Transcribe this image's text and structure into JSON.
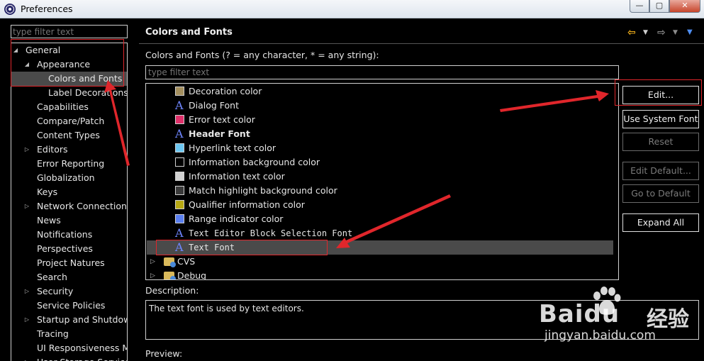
{
  "window": {
    "title": "Preferences",
    "min_glyph": "—",
    "max_glyph": "▢",
    "close_glyph": "✕"
  },
  "left": {
    "filter_placeholder": "type filter text",
    "tree": [
      {
        "label": "General",
        "level": 0,
        "twisty": "◢"
      },
      {
        "label": "Appearance",
        "level": 1,
        "twisty": "◢"
      },
      {
        "label": "Colors and Fonts",
        "level": 2,
        "selected": true
      },
      {
        "label": "Label Decorations",
        "level": 2
      },
      {
        "label": "Capabilities",
        "level": 1
      },
      {
        "label": "Compare/Patch",
        "level": 1
      },
      {
        "label": "Content Types",
        "level": 1
      },
      {
        "label": "Editors",
        "level": 1,
        "twisty": "▷"
      },
      {
        "label": "Error Reporting",
        "level": 1
      },
      {
        "label": "Globalization",
        "level": 1
      },
      {
        "label": "Keys",
        "level": 1
      },
      {
        "label": "Network Connections",
        "level": 1,
        "twisty": "▷"
      },
      {
        "label": "News",
        "level": 1
      },
      {
        "label": "Notifications",
        "level": 1
      },
      {
        "label": "Perspectives",
        "level": 1
      },
      {
        "label": "Project Natures",
        "level": 1
      },
      {
        "label": "Search",
        "level": 1
      },
      {
        "label": "Security",
        "level": 1,
        "twisty": "▷"
      },
      {
        "label": "Service Policies",
        "level": 1
      },
      {
        "label": "Startup and Shutdown",
        "level": 1,
        "twisty": "▷"
      },
      {
        "label": "Tracing",
        "level": 1
      },
      {
        "label": "UI Responsiveness Monitoring",
        "level": 1
      },
      {
        "label": "User Storage Service",
        "level": 1,
        "twisty": "▷"
      }
    ]
  },
  "page": {
    "title": "Colors and Fonts",
    "nav": {
      "back": "⇦",
      "forward": "⇨",
      "dropdown": "▼",
      "menu": "▼"
    },
    "hint": "Colors and Fonts (? = any character, * = any string):",
    "filter_placeholder": "type filter text",
    "items": [
      {
        "label": "Decoration color",
        "kind": "color",
        "color": "#a48f5e"
      },
      {
        "label": "Dialog Font",
        "kind": "font"
      },
      {
        "label": "Error text color",
        "kind": "color",
        "color": "#e0306a"
      },
      {
        "label": "Header Font",
        "kind": "font",
        "style": "bold"
      },
      {
        "label": "Hyperlink text color",
        "kind": "color",
        "color": "#6cc7f2"
      },
      {
        "label": "Information background color",
        "kind": "color",
        "color": "#000000"
      },
      {
        "label": "Information text color",
        "kind": "color",
        "color": "#d2d2d2"
      },
      {
        "label": "Match highlight background color",
        "kind": "color",
        "color": "#3a3a3a"
      },
      {
        "label": "Qualifier information color",
        "kind": "color",
        "color": "#b7a813"
      },
      {
        "label": "Range indicator color",
        "kind": "color",
        "color": "#5a7ff0"
      },
      {
        "label": "Text Editor Block Selection Font",
        "kind": "font",
        "style": "mono"
      },
      {
        "label": "Text Font",
        "kind": "font",
        "style": "mono",
        "selected": true
      }
    ],
    "font_glyph": "A",
    "categories": [
      {
        "label": "CVS",
        "twisty": "▷"
      },
      {
        "label": "Debug",
        "twisty": "▷"
      }
    ],
    "buttons": {
      "edit": "Edit...",
      "use_system_font": "Use System Font",
      "reset": "Reset",
      "edit_default": "Edit Default...",
      "go_to_default": "Go to Default",
      "expand_all": "Expand All"
    },
    "description_label": "Description:",
    "description_text": "The text font is used by text editors.",
    "preview_label": "Preview:"
  },
  "watermark": {
    "brand": "Bai",
    "brand_tail": "du",
    "cn": "经验",
    "url": "jingyan.baidu.com"
  },
  "colors": {
    "annotation": "#e0262b",
    "font_icon": "#6f86ff",
    "selection": "#4a4a4a"
  }
}
